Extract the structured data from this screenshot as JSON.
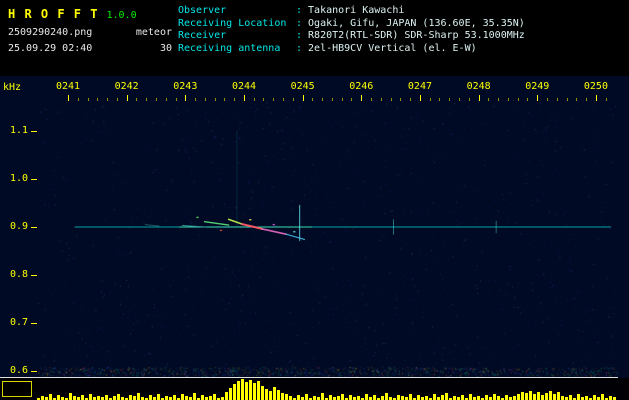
{
  "app": {
    "title": "H R O F F T",
    "version": "1.0.0",
    "filename": "2509290240.png",
    "mode": "meteor",
    "timestamp": "25.09.29 02:40",
    "param": "30"
  },
  "info": {
    "separator": ":",
    "rows": [
      {
        "label": "Observer",
        "value": "Takanori Kawachi"
      },
      {
        "label": "Receiving Location",
        "value": "Ogaki, Gifu, JAPAN (136.60E, 35.35N)"
      },
      {
        "label": "Receiver",
        "value": "R820T2(RTL-SDR) SDR-Sharp 53.1000MHz"
      },
      {
        "label": "Receiving antenna",
        "value": "2el-HB9CV Vertical (el. E-W)"
      }
    ]
  },
  "colors": {
    "title": "#ffff00",
    "version": "#00ee00",
    "file_text": "#e8e8e8",
    "info_label": "#00e8e8",
    "info_value": "#ddf2f2",
    "axis": "#ffff00",
    "plot_bg": "#010a24",
    "separator_line": "#e0e0e0",
    "activity_bars": "#ffff00"
  },
  "chart_data": {
    "type": "heatmap",
    "subtype": "radio-meteor-spectrogram",
    "ylabel": "kHz",
    "xlabel": "",
    "x_tick_labels": [
      "0241",
      "0242",
      "0243",
      "0244",
      "0245",
      "0246",
      "0247",
      "0248",
      "0249",
      "0250"
    ],
    "y_tick_labels": [
      "1.1",
      "1.0",
      "0.9",
      "0.8",
      "0.7",
      "0.6"
    ],
    "y_range_khz": [
      0.59,
      1.16
    ],
    "x_range_minutes": 10,
    "grid": false,
    "carrier": {
      "freq_khz": 0.9,
      "t_start_min": 1.12,
      "t_end_min": 10.25,
      "color": "#00b4b4"
    },
    "carrier_bright": {
      "t1": 2.9,
      "t2": 5.15,
      "color": "#58ffc0",
      "opacity": 0.65
    },
    "echoes": [
      {
        "t1": 2.32,
        "f1": 0.905,
        "t2": 2.55,
        "f2": 0.902,
        "color": "#2f8d8d",
        "w": 1,
        "o": 0.6
      },
      {
        "t1": 2.95,
        "f1": 0.903,
        "t2": 3.35,
        "f2": 0.9,
        "color": "#2f9d9d",
        "w": 1,
        "o": 0.9
      },
      {
        "t1": 3.33,
        "f1": 0.911,
        "t2": 3.74,
        "f2": 0.904,
        "color": "#59d97a",
        "w": 1.4,
        "o": 0.95
      },
      {
        "t1": 3.74,
        "f1": 0.916,
        "t2": 3.97,
        "f2": 0.906,
        "color": "#b8e84a",
        "w": 1.6,
        "o": 0.95
      },
      {
        "t1": 3.97,
        "f1": 0.906,
        "t2": 4.31,
        "f2": 0.896,
        "color": "#ff5a66",
        "w": 2,
        "o": 0.95
      },
      {
        "t1": 4.31,
        "f1": 0.896,
        "t2": 4.72,
        "f2": 0.885,
        "color": "#e86ac2",
        "w": 1.6,
        "o": 0.9
      },
      {
        "t1": 4.72,
        "f1": 0.885,
        "t2": 5.03,
        "f2": 0.874,
        "color": "#49c8ee",
        "w": 1.2,
        "o": 0.85
      }
    ],
    "spikes": [
      {
        "t": 3.88,
        "f1": 1.1,
        "f2": 0.9,
        "color": "#009999",
        "opacity": 0.22
      },
      {
        "t": 4.95,
        "f1": 0.945,
        "f2": 0.872,
        "color": "#66ffff",
        "opacity": 0.75
      },
      {
        "t": 6.55,
        "f1": 0.915,
        "f2": 0.885,
        "color": "#44dddd",
        "opacity": 0.5
      },
      {
        "t": 8.3,
        "f1": 0.912,
        "f2": 0.888,
        "color": "#44dddd",
        "opacity": 0.45
      }
    ],
    "dots": [
      {
        "t": 3.2,
        "f": 0.92,
        "color": "#55cc55"
      },
      {
        "t": 3.6,
        "f": 0.893,
        "color": "#cc4444"
      },
      {
        "t": 4.1,
        "f": 0.915,
        "color": "#dddd55"
      },
      {
        "t": 4.5,
        "f": 0.905,
        "color": "#cc55cc"
      },
      {
        "t": 4.85,
        "f": 0.89,
        "color": "#55cccc"
      }
    ],
    "activity_color": "#ffff00",
    "activity": [
      2,
      4,
      3,
      6,
      2,
      5,
      3,
      2,
      7,
      4,
      3,
      5,
      2,
      6,
      3,
      4,
      3,
      5,
      2,
      4,
      6,
      3,
      2,
      5,
      4,
      7,
      3,
      2,
      5,
      3,
      6,
      2,
      4,
      3,
      5,
      2,
      6,
      4,
      3,
      7,
      2,
      5,
      3,
      4,
      6,
      2,
      3,
      8,
      12,
      16,
      19,
      21,
      18,
      20,
      17,
      19,
      14,
      11,
      9,
      13,
      10,
      7,
      6,
      4,
      2,
      5,
      3,
      6,
      2,
      4,
      3,
      7,
      2,
      5,
      3,
      4,
      6,
      2,
      5,
      3,
      4,
      2,
      6,
      3,
      5,
      2,
      4,
      7,
      3,
      2,
      5,
      4,
      3,
      6,
      2,
      5,
      3,
      4,
      2,
      6,
      3,
      5,
      7,
      2,
      4,
      3,
      5,
      2,
      6,
      3,
      4,
      2,
      5,
      3,
      6,
      4,
      2,
      5,
      3,
      4,
      6,
      8,
      7,
      9,
      6,
      8,
      5,
      7,
      9,
      6,
      8,
      4,
      3,
      5,
      2,
      6,
      3,
      4,
      2,
      5,
      3,
      6,
      2,
      4,
      3
    ]
  }
}
